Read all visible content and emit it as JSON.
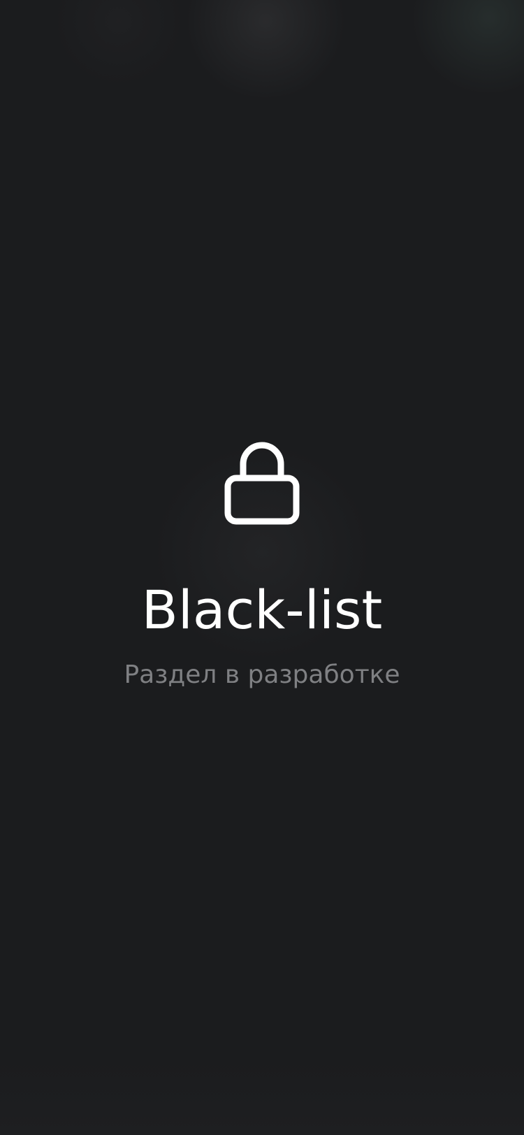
{
  "screen": {
    "title": "Black-list",
    "subtitle": "Раздел в разработке",
    "icon": "lock-icon"
  },
  "colors": {
    "background": "#1b1c1e",
    "title": "#ffffff",
    "subtitle": "#7f8083",
    "icon": "#ffffff"
  }
}
